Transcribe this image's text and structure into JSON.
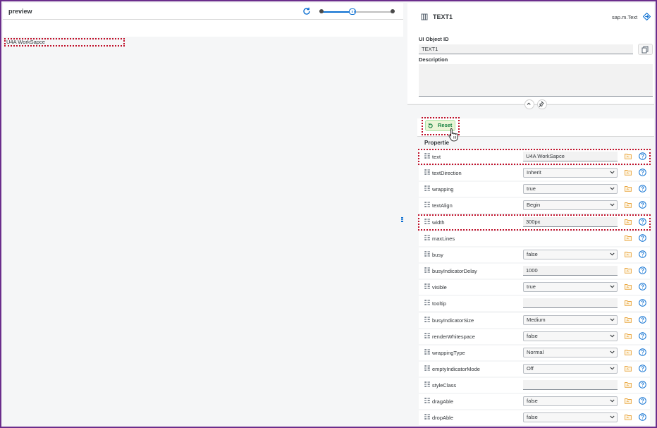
{
  "preview": {
    "title": "preview",
    "rendered_text": "U4A WorkSapce",
    "zoom_slider": {
      "value_fraction": 0.45
    }
  },
  "object": {
    "name": "TEXT1",
    "type": "sap.m.Text",
    "id_label": "UI Object ID",
    "id_value": "TEXT1",
    "description_label": "Description",
    "description_value": ""
  },
  "properties_panel": {
    "reset_label": "Reset",
    "header": "Propertie",
    "rows": [
      {
        "name": "text",
        "value": "U4A WorkSapce",
        "control": "input",
        "highlighted": true
      },
      {
        "name": "textDirection",
        "value": "Inherit",
        "control": "select",
        "highlighted": false
      },
      {
        "name": "wrapping",
        "value": "true",
        "control": "select",
        "highlighted": false
      },
      {
        "name": "textAlign",
        "value": "Begin",
        "control": "select",
        "highlighted": false
      },
      {
        "name": "width",
        "value": "300px",
        "control": "input",
        "highlighted": true
      },
      {
        "name": "maxLines",
        "value": "",
        "control": "none",
        "highlighted": false
      },
      {
        "name": "busy",
        "value": "false",
        "control": "select",
        "highlighted": false
      },
      {
        "name": "busyIndicatorDelay",
        "value": "1000",
        "control": "input",
        "highlighted": false
      },
      {
        "name": "visible",
        "value": "true",
        "control": "select",
        "highlighted": false
      },
      {
        "name": "tooltip",
        "value": "",
        "control": "input",
        "highlighted": false
      },
      {
        "name": "busyIndicatorSize",
        "value": "Medium",
        "control": "select",
        "highlighted": false
      },
      {
        "name": "renderWhitespace",
        "value": "false",
        "control": "select",
        "highlighted": false
      },
      {
        "name": "wrappingType",
        "value": "Normal",
        "control": "select",
        "highlighted": false
      },
      {
        "name": "emptyIndicatorMode",
        "value": "Off",
        "control": "select",
        "highlighted": false
      },
      {
        "name": "styleClass",
        "value": "",
        "control": "input",
        "highlighted": false
      },
      {
        "name": "dragAble",
        "value": "false",
        "control": "select",
        "highlighted": false
      },
      {
        "name": "dropAble",
        "value": "false",
        "control": "select",
        "highlighted": false
      }
    ]
  },
  "icons": {
    "refresh": "refresh-icon",
    "object_type": "text-control-icon",
    "type_link": "diamond-link-icon",
    "copy": "copy-icon",
    "collapse": "chevron-up-icon",
    "pin": "pin-icon",
    "reset": "reset-icon",
    "property": "property-icon",
    "folder": "folder-icon",
    "help": "help-icon",
    "cursor": "hand-cursor-icon"
  },
  "colors": {
    "frame_border": "#6b2e8c",
    "highlight_outline": "#c0102a",
    "accent_blue": "#0a6ed1",
    "reset_green": "#107e3e",
    "reset_bg": "#ebf5d6",
    "folder_yellow": "#e9a640"
  }
}
